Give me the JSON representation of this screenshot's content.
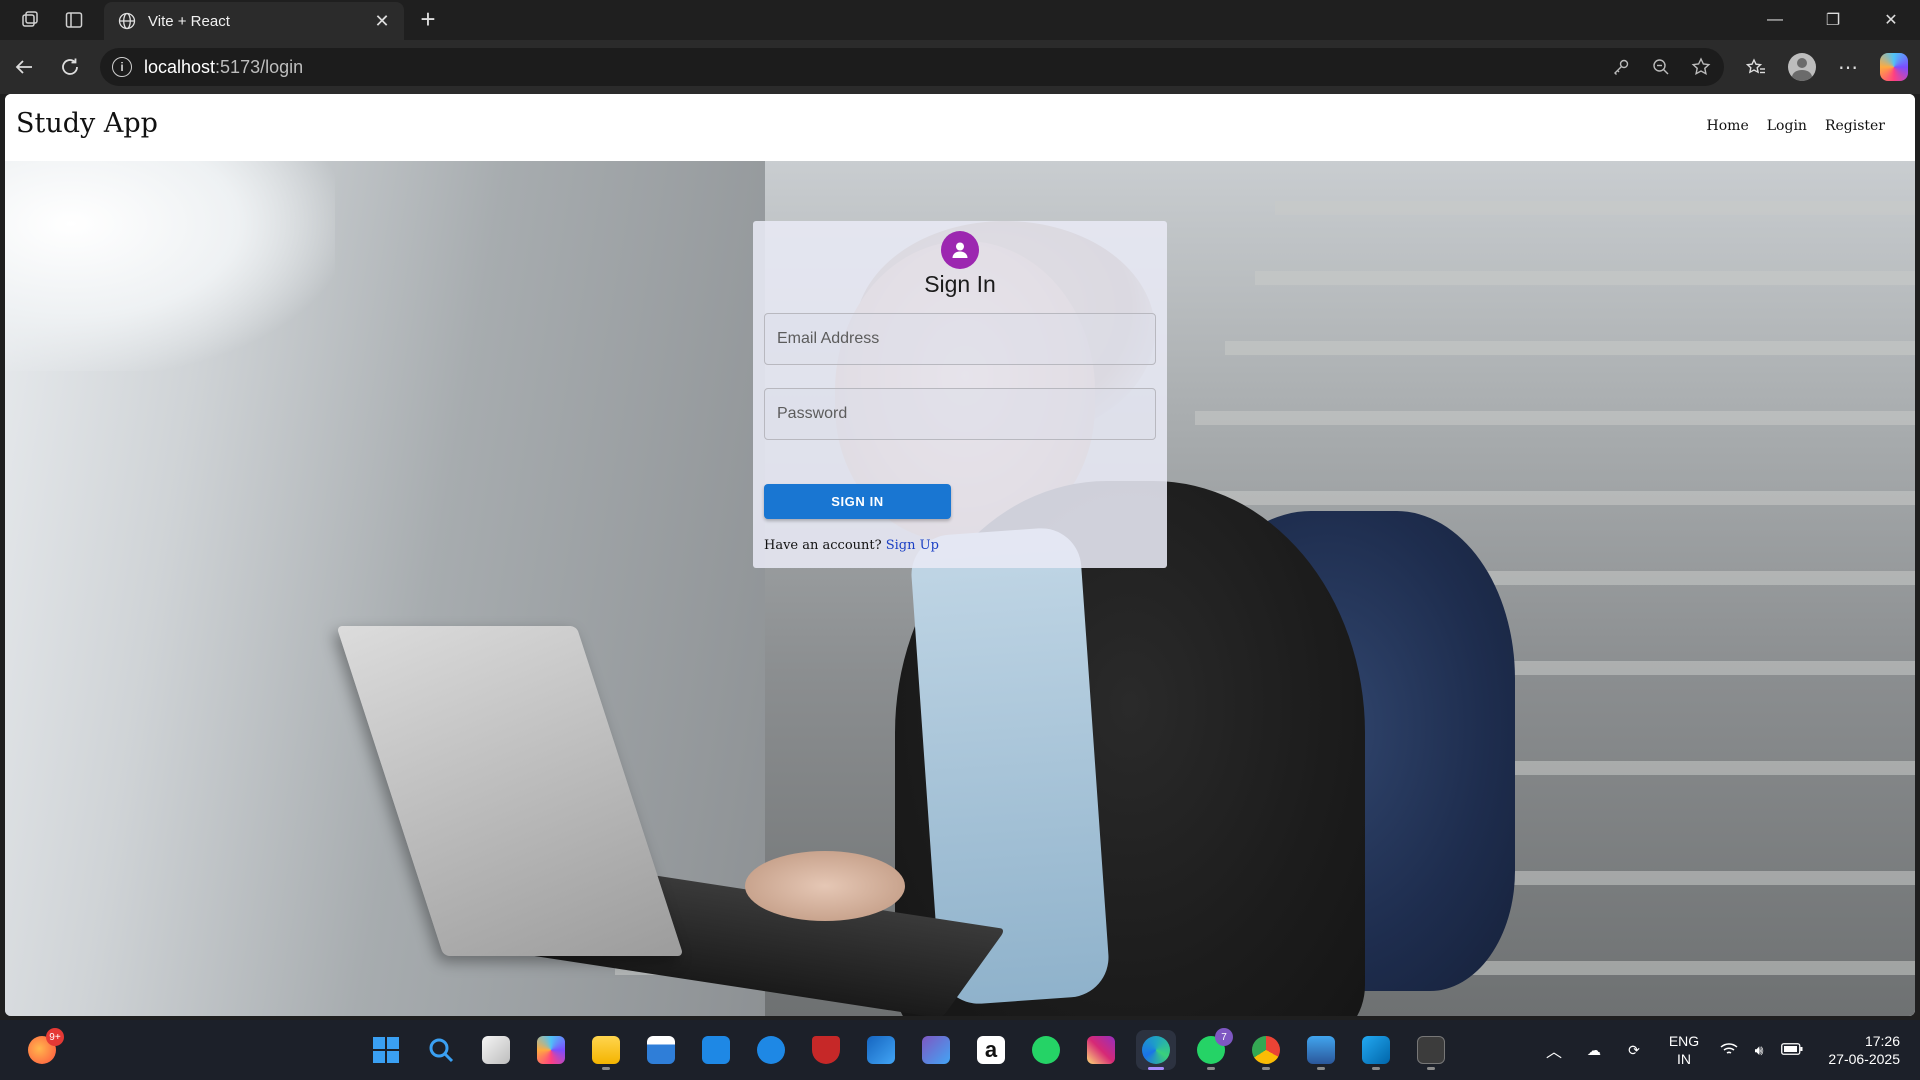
{
  "browser": {
    "tab_title": "Vite + React",
    "new_tab_symbol": "+",
    "url_host": "localhost",
    "url_path": ":5173/login",
    "icons": [
      "workspaces-icon",
      "vertical-tabs-icon",
      "globe-icon",
      "close-tab-icon",
      "back-icon",
      "refresh-icon",
      "info-icon",
      "key-icon",
      "zoom-out-icon",
      "favorite-star-icon",
      "favorites-icon",
      "profile-icon",
      "more-icon",
      "copilot-icon",
      "minimize-icon",
      "maximize-icon",
      "close-window-icon"
    ]
  },
  "app": {
    "brand": "Study App",
    "nav": [
      "Home",
      "Login",
      "Register"
    ]
  },
  "login": {
    "title": "Sign In",
    "email_placeholder": "Email Address",
    "password_placeholder": "Password",
    "submit_label": "SIGN IN",
    "have_account_text": "Have an account?",
    "signup_link": "Sign Up",
    "avatar_color": "#9c27b0",
    "button_color": "#1976d2"
  },
  "taskbar": {
    "apps": [
      {
        "name": "start",
        "color": "#3aa0f3"
      },
      {
        "name": "search",
        "color": "#3aa0f3"
      },
      {
        "name": "task-view",
        "color": "#d9d9d9"
      },
      {
        "name": "copilot",
        "color": "#7c4dff"
      },
      {
        "name": "file-explorer",
        "color": "#f4c430"
      },
      {
        "name": "microsoft-store",
        "color": "#2f7ed8"
      },
      {
        "name": "myhp",
        "color": "#1e88e5"
      },
      {
        "name": "get-help",
        "color": "#1e88e5"
      },
      {
        "name": "mcafee",
        "color": "#c62828"
      },
      {
        "name": "outlook",
        "color": "#1565c0"
      },
      {
        "name": "clipchamp",
        "color": "#5e35b1"
      },
      {
        "name": "amazon",
        "color": "#ffffff"
      },
      {
        "name": "whatsapp",
        "color": "#25d366"
      },
      {
        "name": "instagram",
        "color": "#e1306c"
      },
      {
        "name": "edge",
        "color": "#1fa2c4"
      },
      {
        "name": "whatsapp-beta",
        "color": "#25d366"
      },
      {
        "name": "chrome",
        "color": "#fbbc05"
      },
      {
        "name": "word",
        "color": "#2b579a"
      },
      {
        "name": "vscode",
        "color": "#23a9f2"
      },
      {
        "name": "terminal",
        "color": "#3c3c3c"
      }
    ],
    "weather_badge": "9+",
    "whatsapp_badge": "7",
    "language": "ENG",
    "region": "IN",
    "time": "17:26",
    "date": "27-06-2025"
  }
}
